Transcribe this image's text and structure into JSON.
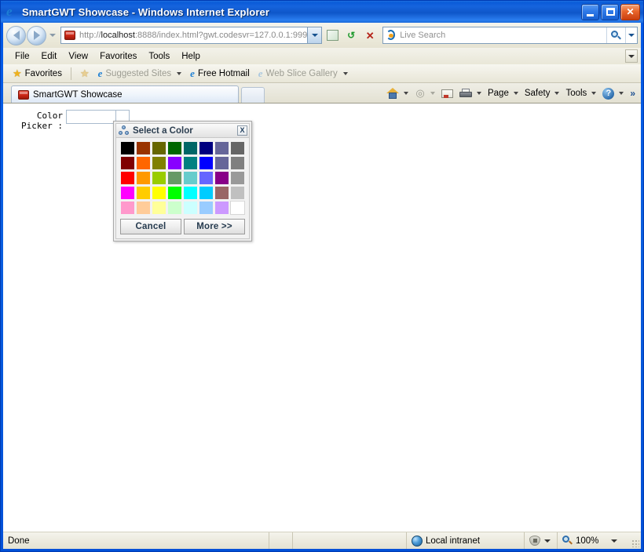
{
  "window": {
    "title": "SmartGWT Showcase - Windows Internet Explorer",
    "app_icon": "ie-logo-icon",
    "minimize_label": "",
    "maximize_label": "",
    "close_label": "✕"
  },
  "navigation": {
    "back_icon": "back-arrow-icon",
    "forward_icon": "forward-arrow-icon",
    "recent_pages_icon": "chevron-down-icon",
    "address": {
      "icon": "toolbox-icon",
      "scheme": "http://",
      "host": "localhost",
      "rest": ":8888/index.html?gwt.codesvr=127.0.0.1:999",
      "dropdown_icon": "chevron-down-icon"
    },
    "compatibility_icon": "compatibility-view-icon",
    "refresh_icon": "refresh-icon",
    "stop_icon": "stop-icon",
    "search": {
      "provider_icon": "bing-icon",
      "placeholder": "Live Search",
      "value": "",
      "go_icon": "search-icon",
      "dropdown_icon": "chevron-down-icon"
    }
  },
  "menubar": {
    "items": [
      {
        "label": "File"
      },
      {
        "label": "Edit"
      },
      {
        "label": "View"
      },
      {
        "label": "Favorites"
      },
      {
        "label": "Tools"
      },
      {
        "label": "Help"
      }
    ],
    "overflow_icon": "chevron-down-icon"
  },
  "favorites_bar": {
    "favorites_label": "Favorites",
    "favorites_icon": "star-icon",
    "add_icon": "add-to-favorites-icon",
    "items": [
      {
        "label": "Suggested Sites",
        "icon": "ie-icon",
        "dimmed": true,
        "has_caret": true
      },
      {
        "label": "Free Hotmail",
        "icon": "ie-icon",
        "dimmed": false,
        "has_caret": false
      },
      {
        "label": "Web Slice Gallery",
        "icon": "ie-icon",
        "dimmed": true,
        "has_caret": true
      }
    ]
  },
  "tabs": {
    "items": [
      {
        "label": "SmartGWT Showcase",
        "icon": "toolbox-icon",
        "active": true
      }
    ],
    "new_tab_label": "",
    "command_bar": [
      {
        "label": "",
        "icon": "home-icon",
        "has_caret": true
      },
      {
        "label": "",
        "icon": "rss-feeds-icon",
        "has_caret": true
      },
      {
        "label": "",
        "icon": "read-mail-icon",
        "has_caret": false
      },
      {
        "label": "",
        "icon": "print-icon",
        "has_caret": true
      },
      {
        "label": "Page",
        "icon": "",
        "has_caret": true
      },
      {
        "label": "Safety",
        "icon": "",
        "has_caret": true
      },
      {
        "label": "Tools",
        "icon": "",
        "has_caret": true
      },
      {
        "label": "",
        "icon": "help-icon",
        "has_caret": true
      }
    ],
    "overflow_label": "»"
  },
  "page": {
    "form": {
      "label_line1": "Color",
      "label_line2": "Picker :",
      "input_value": "",
      "input_placeholder": "",
      "picker_button_icon": "color-picker-icon"
    },
    "dialog": {
      "title": "Select a Color",
      "title_icon": "color-swatches-icon",
      "close_label": "X",
      "cancel_label": "Cancel",
      "more_label": "More >>",
      "swatch_rows": [
        [
          "#000000",
          "#993300",
          "#666600",
          "#006600",
          "#006666",
          "#000080",
          "#666699",
          "#666666"
        ],
        [
          "#800000",
          "#FF6600",
          "#808000",
          "#8800FF",
          "#008080",
          "#0000FF",
          "#666699",
          "#808080"
        ],
        [
          "#FF0000",
          "#FF9900",
          "#99CC00",
          "#669966",
          "#66CCCC",
          "#6666FF",
          "#880088",
          "#999999"
        ],
        [
          "#FF00FF",
          "#FFCC00",
          "#FFFF00",
          "#00FF00",
          "#00FFFF",
          "#00CCFF",
          "#996666",
          "#C0C0C0"
        ],
        [
          "#FF99CC",
          "#FFCC99",
          "#FFFF99",
          "#CCFFCC",
          "#CCFFFF",
          "#99CCFF",
          "#CC99FF",
          "#FFFFFF"
        ]
      ]
    }
  },
  "statusbar": {
    "status_text": "Done",
    "zone_label": "Local intranet",
    "zone_icon": "intranet-globe-icon",
    "zone_caret_icon": "chevron-down-icon",
    "security_icon": "protected-mode-icon",
    "security_caret_icon": "chevron-down-icon",
    "zoom_label": "100%",
    "zoom_icon": "zoom-magnifier-icon",
    "zoom_caret_icon": "chevron-down-icon",
    "resize_grip_icon": "resize-grip-icon"
  },
  "colors": {
    "titlebar_blue": "#0a5bd8",
    "chrome_beige": "#ece9d8",
    "page_white": "#ffffff",
    "dialog_gray": "#f2f2f2"
  }
}
